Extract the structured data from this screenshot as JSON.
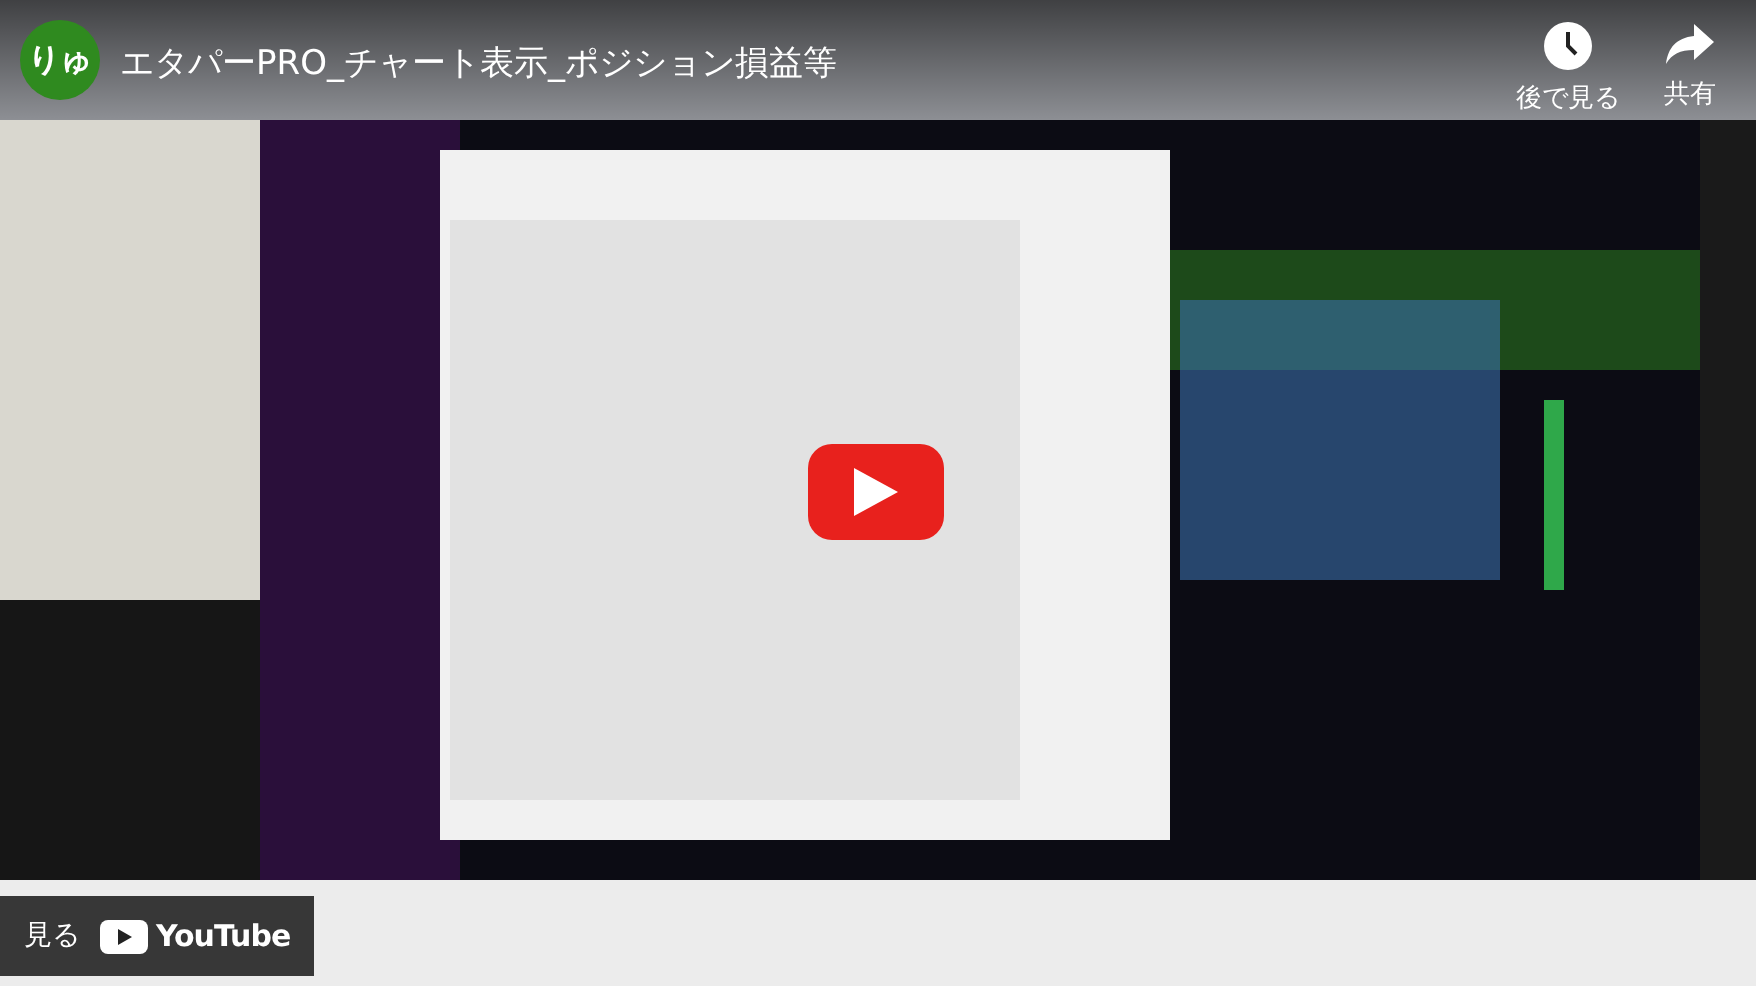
{
  "channel": {
    "avatar_text": "りゅ"
  },
  "title": "エタパーPRO_チャート表示_ポジション損益等",
  "actions": [
    {
      "kind": "watch_later",
      "label": "後で見る"
    },
    {
      "kind": "share",
      "label": "共有"
    }
  ],
  "watch_on": {
    "label": "見る",
    "logo_text": "YouTube"
  }
}
